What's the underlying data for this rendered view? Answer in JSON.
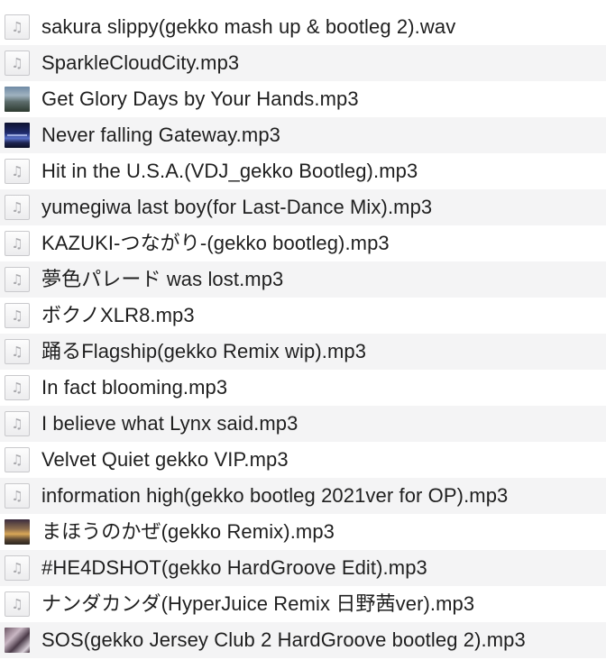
{
  "files": [
    {
      "name": "sakura slippy(gekko mash up & bootleg 2).wav",
      "icon": "audio-file-icon"
    },
    {
      "name": "SparkleCloudCity.mp3",
      "icon": "audio-file-icon"
    },
    {
      "name": "Get Glory Days by Your Hands.mp3",
      "icon": "album-art-thumbnail"
    },
    {
      "name": "Never falling Gateway.mp3",
      "icon": "album-art-thumbnail"
    },
    {
      "name": "Hit in the U.S.A.(VDJ_gekko Bootleg).mp3",
      "icon": "audio-file-icon"
    },
    {
      "name": "yumegiwa last boy(for Last-Dance Mix).mp3",
      "icon": "audio-file-icon"
    },
    {
      "name": "KAZUKI-つながり-(gekko bootleg).mp3",
      "icon": "audio-file-icon"
    },
    {
      "name": "夢色パレード was lost.mp3",
      "icon": "audio-file-icon"
    },
    {
      "name": "ボクノXLR8.mp3",
      "icon": "audio-file-icon"
    },
    {
      "name": "踊るFlagship(gekko Remix wip).mp3",
      "icon": "audio-file-icon"
    },
    {
      "name": "In fact blooming.mp3",
      "icon": "audio-file-icon"
    },
    {
      "name": "I believe what Lynx said.mp3",
      "icon": "audio-file-icon"
    },
    {
      "name": "Velvet Quiet gekko VIP.mp3",
      "icon": "audio-file-icon"
    },
    {
      "name": "information high(gekko bootleg 2021ver for OP).mp3",
      "icon": "audio-file-icon"
    },
    {
      "name": "まほうのかぜ(gekko Remix).mp3",
      "icon": "album-art-thumbnail"
    },
    {
      "name": "#HE4DSHOT(gekko HardGroove Edit).mp3",
      "icon": "audio-file-icon"
    },
    {
      "name": "ナンダカンダ(HyperJuice Remix 日野茜ver).mp3",
      "icon": "audio-file-icon"
    },
    {
      "name": "SOS(gekko Jersey Club 2 HardGroove bootleg 2).mp3",
      "icon": "album-art-thumbnail"
    }
  ],
  "audio_icon_glyph": "♫"
}
